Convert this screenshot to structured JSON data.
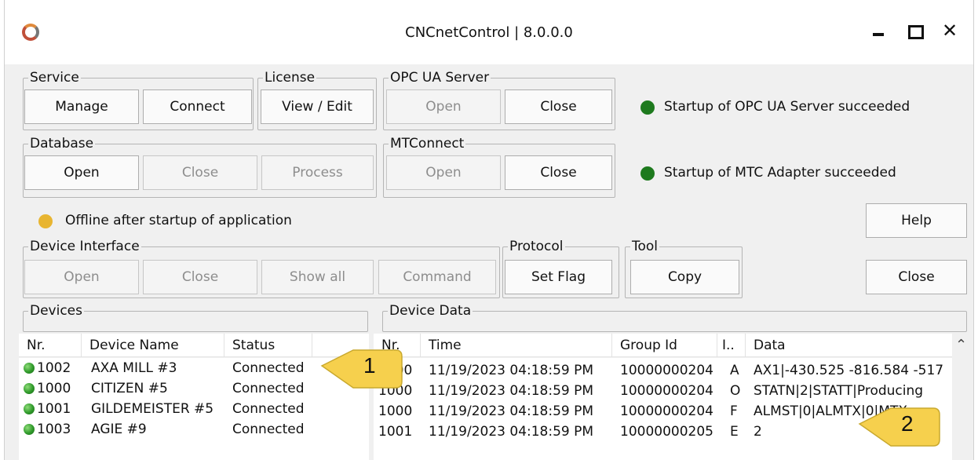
{
  "window": {
    "title": "CNCnetControl | 8.0.0.0"
  },
  "groups": {
    "service": {
      "legend": "Service",
      "manage": "Manage",
      "connect": "Connect"
    },
    "license": {
      "legend": "License",
      "view_edit": "View / Edit"
    },
    "opc_ua": {
      "legend": "OPC UA Server",
      "open": "Open",
      "close": "Close"
    },
    "database": {
      "legend": "Database",
      "open": "Open",
      "close": "Close",
      "process": "Process"
    },
    "mtconnect": {
      "legend": "MTConnect",
      "open": "Open",
      "close": "Close"
    },
    "device_interface": {
      "legend": "Device Interface",
      "open": "Open",
      "close": "Close",
      "show_all": "Show all",
      "command": "Command"
    },
    "protocol": {
      "legend": "Protocol",
      "set_flag": "Set Flag"
    },
    "tool": {
      "legend": "Tool",
      "copy": "Copy"
    },
    "devices": {
      "legend": "Devices"
    },
    "device_data": {
      "legend": "Device Data"
    }
  },
  "status": {
    "opc_ua": {
      "text": "Startup of OPC UA Server succeeded",
      "color": "#1e7a1e"
    },
    "mtc": {
      "text": "Startup of MTC Adapter succeeded",
      "color": "#1e7a1e"
    },
    "app": {
      "text": "Offline after startup of application",
      "color": "#e8b531"
    }
  },
  "side_buttons": {
    "help": "Help",
    "close": "Close"
  },
  "devices_table": {
    "columns": {
      "nr": "Nr.",
      "device_name": "Device Name",
      "status": "Status"
    },
    "rows": [
      {
        "nr": "1002",
        "name": "AXA MILL #3",
        "status": "Connected"
      },
      {
        "nr": "1000",
        "name": "CITIZEN #5",
        "status": "Connected"
      },
      {
        "nr": "1001",
        "name": "GILDEMEISTER #5",
        "status": "Connected"
      },
      {
        "nr": "1003",
        "name": "AGIE #9",
        "status": "Connected"
      }
    ]
  },
  "data_table": {
    "columns": {
      "nr": "Nr.",
      "time": "Time",
      "group_id": "Group Id",
      "i": "I..",
      "data": "Data"
    },
    "rows": [
      {
        "nr": "1000",
        "time": "11/19/2023 04:18:59 PM",
        "group_id": "10000000204",
        "i": "A",
        "data": "AX1|-430.525 -816.584 -517"
      },
      {
        "nr": "1000",
        "time": "11/19/2023 04:18:59 PM",
        "group_id": "10000000204",
        "i": "O",
        "data": "STATN|2|STATT|Producing"
      },
      {
        "nr": "1000",
        "time": "11/19/2023 04:18:59 PM",
        "group_id": "10000000204",
        "i": "F",
        "data": "ALMST|0|ALMTX|0|MTX"
      },
      {
        "nr": "1001",
        "time": "11/19/2023 04:18:59 PM",
        "group_id": "10000000205",
        "i": "E",
        "data": "2"
      }
    ]
  },
  "callouts": {
    "one": "1",
    "two": "2",
    "color": "#f6d04d"
  }
}
